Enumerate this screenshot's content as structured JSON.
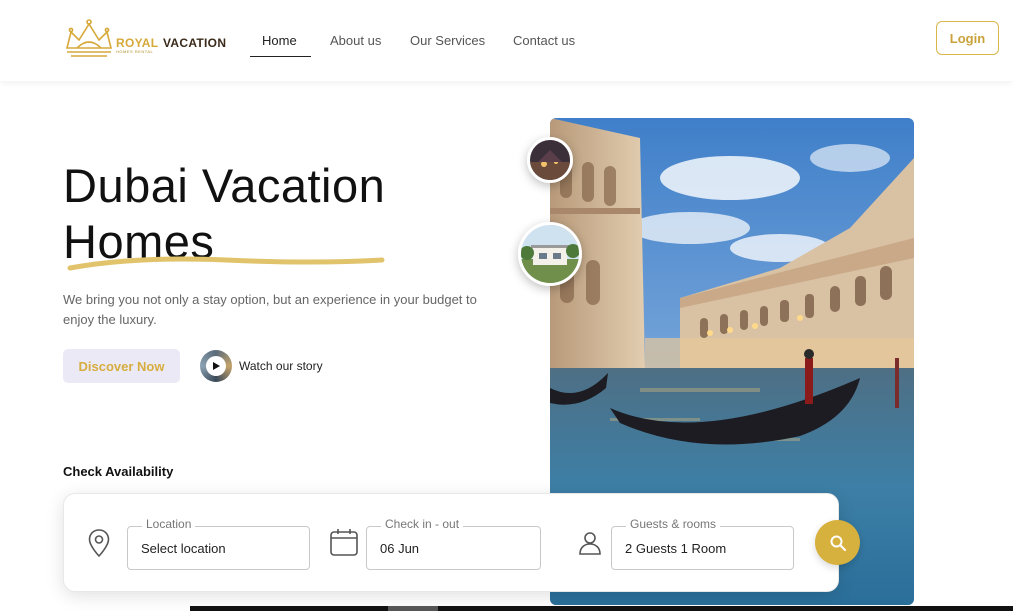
{
  "header": {
    "logo": {
      "brand_primary": "ROYAL",
      "brand_secondary": "VACATION",
      "tagline": "HOMES RENTAL"
    },
    "nav": [
      {
        "label": "Home",
        "active": true
      },
      {
        "label": "About us",
        "active": false
      },
      {
        "label": "Our Services",
        "active": false
      },
      {
        "label": "Contact us",
        "active": false
      }
    ],
    "login_label": "Login"
  },
  "hero": {
    "title_line1": "Dubai Vacation",
    "title_line2": "Homes",
    "description": "We bring you not only a stay option, but an experience in your budget to enjoy the luxury.",
    "discover_label": "Discover Now",
    "watch_label": "Watch our story"
  },
  "availability": {
    "title": "Check Availability",
    "location": {
      "label": "Location",
      "value": "Select location",
      "icon": "map-pin-icon"
    },
    "dates": {
      "label": "Check in - out",
      "value": "06 Jun",
      "icon": "calendar-icon"
    },
    "guests": {
      "label": "Guests & rooms",
      "value": "2 Guests 1 Room",
      "icon": "user-icon"
    },
    "search_icon": "search-icon"
  },
  "colors": {
    "accent_gold": "#d7b13d",
    "discover_bg": "#ece9f6",
    "text_dark": "#111111",
    "text_muted": "#666666"
  }
}
